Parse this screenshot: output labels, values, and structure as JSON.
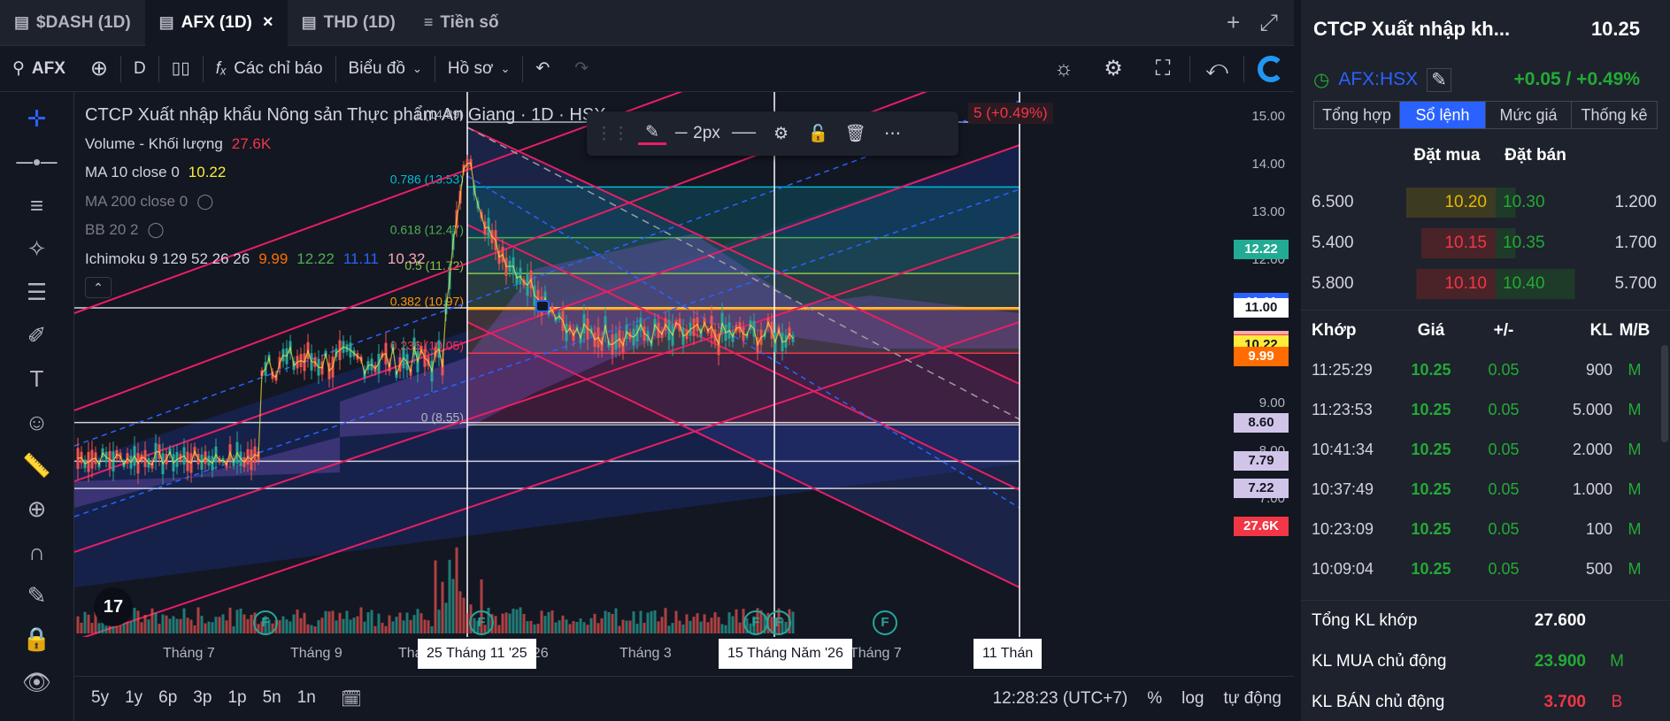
{
  "tabs": [
    {
      "label": "$DASH (1D)",
      "icon": "chart-icon",
      "active": false
    },
    {
      "label": "AFX (1D)",
      "icon": "chart-icon",
      "active": true
    },
    {
      "label": "THD (1D)",
      "icon": "chart-icon",
      "active": false
    },
    {
      "label": "Tiền số",
      "icon": "list-icon",
      "active": false
    }
  ],
  "toolbar": {
    "symbol": "AFX",
    "interval": "D",
    "indicators_label": "Các chỉ báo",
    "chart_label": "Biểu đồ",
    "profile_label": "Hồ sơ"
  },
  "legend": {
    "title": "CTCP Xuất nhập khẩu Nông sản Thực phẩm An Giang · 1D · HSX",
    "volume_label": "Volume - Khối lượng",
    "volume_value": "27.6K",
    "ma10_label": "MA 10 close 0",
    "ma10_value": "10.22",
    "ma200_label": "MA 200 close 0",
    "bb_label": "BB 20 2",
    "ichimoku_label": "Ichimoku 9 129 52 26 26",
    "ichimoku_values": [
      "9.99",
      "12.22",
      "11.11",
      "10.32"
    ],
    "change_badge": "5 (+0.49%)"
  },
  "drawing_toolbar": {
    "width_label": "2px"
  },
  "fib_labels": [
    {
      "text": "1 (14.89)",
      "color": "#b2b5be",
      "price": 14.89
    },
    {
      "text": "0.786 (13.53)",
      "color": "#00bcd4",
      "price": 13.53
    },
    {
      "text": "0.618 (12.47)",
      "color": "#4caf50",
      "price": 12.47
    },
    {
      "text": "0.5 (11.72)",
      "color": "#8bc34a",
      "price": 11.72
    },
    {
      "text": "0.382 (10.97)",
      "color": "#ff9800",
      "price": 10.97
    },
    {
      "text": "0.236 (10.05)",
      "color": "#f23645",
      "price": 10.05
    },
    {
      "text": "0 (8.55)",
      "color": "#b2b5be",
      "price": 8.55
    }
  ],
  "price_ticks": [
    "15.00",
    "14.00",
    "13.00",
    "12.00",
    "11.00",
    "10.00",
    "9.00",
    "8.00",
    "7.00"
  ],
  "price_badges": [
    {
      "text": "12.22",
      "bg": "#22ab94",
      "fg": "#ffffff",
      "price": 12.22
    },
    {
      "text": "11.11",
      "bg": "#2962ff",
      "fg": "#ffffff",
      "price": 11.11
    },
    {
      "text": "11.00",
      "bg": "#ffffff",
      "fg": "#131722",
      "price": 11.0
    },
    {
      "text": "10.32",
      "bg": "#f7a8b0",
      "fg": "#131722",
      "price": 10.32
    },
    {
      "text": "10.25",
      "bg": "#f23645",
      "fg": "#ffffff",
      "price": 10.25
    },
    {
      "text": "10.22",
      "bg": "#ffeb3b",
      "fg": "#131722",
      "price": 10.22
    },
    {
      "text": "9.99",
      "bg": "#ff6d00",
      "fg": "#ffffff",
      "price": 9.99
    },
    {
      "text": "8.60",
      "bg": "#d1c4e9",
      "fg": "#131722",
      "price": 8.6
    },
    {
      "text": "7.79",
      "bg": "#d1c4e9",
      "fg": "#131722",
      "price": 7.79
    },
    {
      "text": "7.22",
      "bg": "#d1c4e9",
      "fg": "#131722",
      "price": 7.22
    },
    {
      "text": "27.6K",
      "bg": "#f23645",
      "fg": "#ffffff",
      "price": 6.4
    }
  ],
  "time_ticks": [
    "Tháng 7",
    "Tháng 9",
    "Thá",
    "2026",
    "Tháng 3",
    "Tháng 7"
  ],
  "time_badges": [
    "25 Tháng 11 '25",
    "15 Tháng Năm '26",
    "11 Thán"
  ],
  "bottom": {
    "ranges": [
      "5y",
      "1y",
      "6p",
      "3p",
      "1p",
      "5n",
      "1n"
    ],
    "clock": "12:28:23 (UTC+7)",
    "percent": "%",
    "log": "log",
    "auto": "tự động"
  },
  "panel": {
    "name": "CTCP Xuất nhập kh...",
    "price": "10.25",
    "code": "AFX:HSX",
    "change": "+0.05 / +0.49%",
    "tabs": [
      "Tổng hợp",
      "Sổ lệnh",
      "Mức giá",
      "Thống kê"
    ],
    "active_tab": 1,
    "ob_headers": {
      "bid": "Đặt mua",
      "ask": "Đặt bán"
    },
    "orderbook": [
      {
        "bid_vol": "6.500",
        "bid": "10.20",
        "ask": "10.30",
        "ask_vol": "1.200",
        "bid_color": "#e6b800",
        "bid_bg": "#3d3a22",
        "bid_fill": 0.9,
        "ask_fill": 0.2
      },
      {
        "bid_vol": "5.400",
        "bid": "10.15",
        "ask": "10.35",
        "ask_vol": "1.700",
        "bid_color": "#f23645",
        "bid_bg": "#4a2328",
        "bid_fill": 0.75,
        "ask_fill": 0.2
      },
      {
        "bid_vol": "5.800",
        "bid": "10.10",
        "ask": "10.40",
        "ask_vol": "5.700",
        "bid_color": "#f23645",
        "bid_bg": "#4a2328",
        "bid_fill": 0.8,
        "ask_fill": 0.8
      }
    ],
    "trade_headers": [
      "Khớp",
      "Giá",
      "+/-",
      "KL",
      "M/B"
    ],
    "trades": [
      {
        "time": "11:25:29",
        "price": "10.25",
        "chg": "0.05",
        "vol": "900",
        "side": "M"
      },
      {
        "time": "11:23:53",
        "price": "10.25",
        "chg": "0.05",
        "vol": "5.000",
        "side": "M"
      },
      {
        "time": "10:41:34",
        "price": "10.25",
        "chg": "0.05",
        "vol": "2.000",
        "side": "M"
      },
      {
        "time": "10:37:49",
        "price": "10.25",
        "chg": "0.05",
        "vol": "1.000",
        "side": "M"
      },
      {
        "time": "10:23:09",
        "price": "10.25",
        "chg": "0.05",
        "vol": "100",
        "side": "M"
      },
      {
        "time": "10:09:04",
        "price": "10.25",
        "chg": "0.05",
        "vol": "500",
        "side": "M"
      }
    ],
    "summary": [
      {
        "label": "Tổng KL khớp",
        "value": "27.600",
        "color": "#ffffff",
        "tag": ""
      },
      {
        "label": "KL MUA chủ động",
        "value": "23.900",
        "color": "#22ab34",
        "tag": "M",
        "tag_color": "#22ab34"
      },
      {
        "label": "KL BÁN chủ động",
        "value": "3.700",
        "color": "#f23645",
        "tag": "B",
        "tag_color": "#f23645"
      }
    ]
  },
  "colors": {
    "accent": "#2962ff",
    "up": "#22ab34",
    "down": "#f23645",
    "channel": "#e91e63"
  }
}
